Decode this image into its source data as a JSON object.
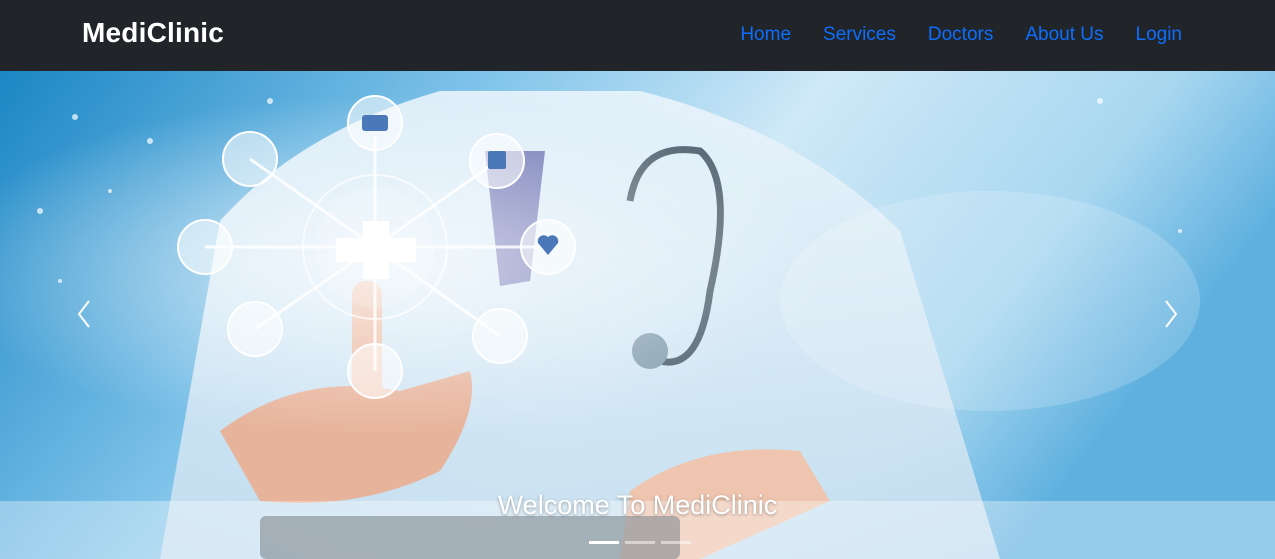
{
  "navbar": {
    "brand": "MediClinic",
    "links": [
      "Home",
      "Services",
      "Doctors",
      "About Us",
      "Login"
    ],
    "link_color": "#0d6efd",
    "background": "#212529"
  },
  "carousel": {
    "caption": "Welcome To MediClinic",
    "slide_count": 3,
    "active_slide": 1,
    "prev_icon": "chevron-left-icon",
    "next_icon": "chevron-right-icon"
  }
}
